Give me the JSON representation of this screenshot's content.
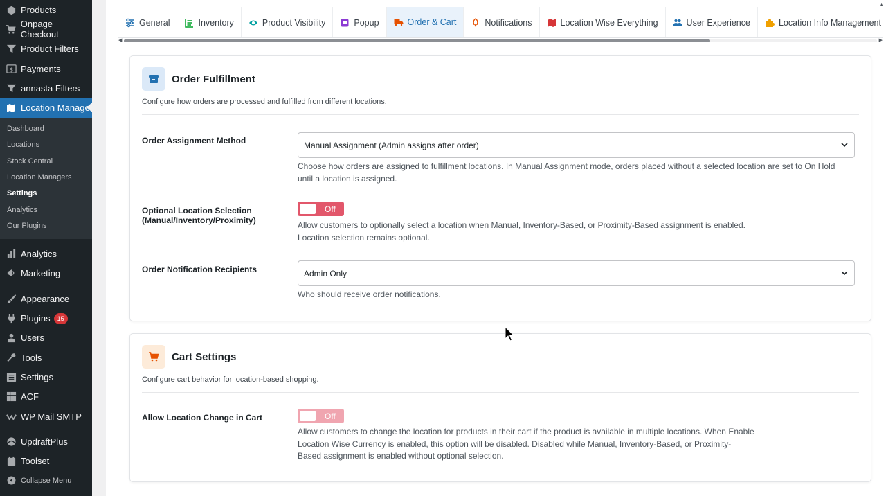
{
  "sidebar": {
    "top_items": [
      {
        "label": "Products",
        "icon": "products-icon"
      },
      {
        "label": "Onpage Checkout",
        "icon": "cart-icon"
      },
      {
        "label": "Product Filters",
        "icon": "filter-icon"
      },
      {
        "label": "Payments",
        "icon": "dollar-icon"
      },
      {
        "label": "annasta Filters",
        "icon": "filter-icon"
      }
    ],
    "active_item": {
      "label": "Location Manage",
      "icon": "location-icon"
    },
    "submenu": [
      "Dashboard",
      "Locations",
      "Stock Central",
      "Location Managers",
      "Settings",
      "Analytics",
      "Our Plugins"
    ],
    "current_submenu": "Settings",
    "lower_items": [
      {
        "label": "Analytics",
        "icon": "bar-chart-icon"
      },
      {
        "label": "Marketing",
        "icon": "megaphone-icon"
      }
    ],
    "tools_items": [
      {
        "label": "Appearance",
        "icon": "brush-icon"
      },
      {
        "label": "Plugins",
        "icon": "plugin-icon",
        "badge": "15"
      },
      {
        "label": "Users",
        "icon": "users-icon"
      },
      {
        "label": "Tools",
        "icon": "wrench-icon"
      },
      {
        "label": "Settings",
        "icon": "settings-icon"
      },
      {
        "label": "ACF",
        "icon": "acf-icon"
      },
      {
        "label": "WP Mail SMTP",
        "icon": "mail-icon"
      }
    ],
    "bottom_items": [
      {
        "label": "UpdraftPlus",
        "icon": "updraft-icon"
      },
      {
        "label": "Toolset",
        "icon": "toolset-icon"
      }
    ],
    "collapse": "Collapse Menu"
  },
  "tabs": [
    {
      "label": "General",
      "icon": "sliders-icon",
      "color": "#2271b1"
    },
    {
      "label": "Inventory",
      "icon": "list-icon",
      "color": "#00a32a"
    },
    {
      "label": "Product Visibility",
      "icon": "eye-icon",
      "color": "#00a0a0"
    },
    {
      "label": "Popup",
      "icon": "popup-icon",
      "color": "#8c3ad4"
    },
    {
      "label": "Order & Cart",
      "icon": "truck-icon",
      "color": "#e65100",
      "active": true
    },
    {
      "label": "Notifications",
      "icon": "bell-icon",
      "color": "#e65100"
    },
    {
      "label": "Location Wise Everything",
      "icon": "map-icon",
      "color": "#d63638"
    },
    {
      "label": "User Experience",
      "icon": "users-icon",
      "color": "#2271b1"
    },
    {
      "label": "Location Info Management",
      "icon": "puzzle-icon",
      "color": "#f0a000"
    },
    {
      "label": "",
      "icon": "list-icon",
      "color": "#2271b1"
    }
  ],
  "order_fulfillment": {
    "title": "Order Fulfillment",
    "description": "Configure how orders are processed and fulfilled from different locations.",
    "assignment_label": "Order Assignment Method",
    "assignment_value": "Manual Assignment (Admin assigns after order)",
    "assignment_help": "Choose how orders are assigned to fulfillment locations. In Manual Assignment mode, orders placed without a selected location are set to On Hold until a location is assigned.",
    "optional_label": "Optional Location Selection (Manual/Inventory/Proximity)",
    "optional_toggle": "Off",
    "optional_help_1": "Allow customers to optionally select a location when Manual, Inventory-Based, or Proximity-Based assignment is enabled.",
    "optional_help_2": "Location selection remains optional.",
    "recipients_label": "Order Notification Recipients",
    "recipients_value": "Admin Only",
    "recipients_help": "Who should receive order notifications."
  },
  "cart_settings": {
    "title": "Cart Settings",
    "description": "Configure cart behavior for location-based shopping.",
    "change_label": "Allow Location Change in Cart",
    "change_toggle": "Off",
    "change_help": "Allow customers to change the location for products in their cart if the product is available in multiple locations. When Enable Location Wise Currency is enabled, this option will be disabled. Disabled while Manual, Inventory-Based, or Proximity-Based assignment is enabled without optional selection."
  },
  "colors": {
    "accent": "#2271b1",
    "toggle_off": "#e2576b",
    "toggle_disabled": "#f0a5b0"
  }
}
